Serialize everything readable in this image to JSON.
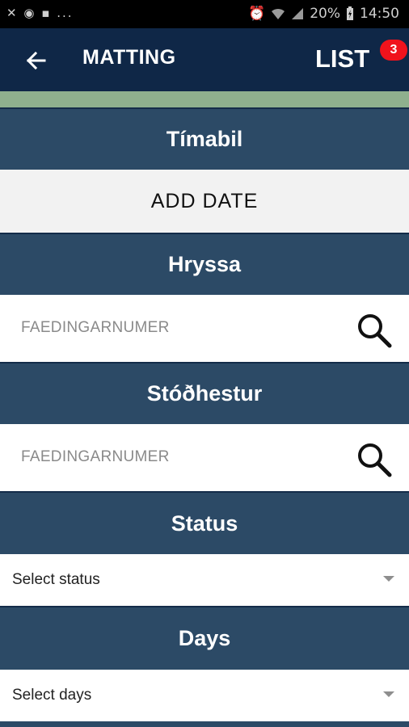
{
  "status_bar": {
    "left_icons": [
      "close-notification-icon",
      "circle-icon",
      "sd-icon"
    ],
    "left_ellipsis": "...",
    "battery_percent": "20%",
    "time": "14:50"
  },
  "app_bar": {
    "title": "MATTING",
    "list_label": "LIST",
    "list_badge": "3"
  },
  "sections": {
    "timabil": {
      "header": "Tímabil",
      "add_date_label": "ADD DATE"
    },
    "hryssa": {
      "header": "Hryssa",
      "placeholder": "FAEDINGARNUMER"
    },
    "stodhestur": {
      "header": "Stóðhestur",
      "placeholder": "FAEDINGARNUMER"
    },
    "status": {
      "header": "Status",
      "selected": "Select status"
    },
    "days": {
      "header": "Days",
      "selected": "Select days"
    }
  },
  "colors": {
    "app_bar": "#0f2747",
    "section_header": "#2c4a66",
    "green_strip": "#8fb08e",
    "badge": "#f0131c"
  }
}
